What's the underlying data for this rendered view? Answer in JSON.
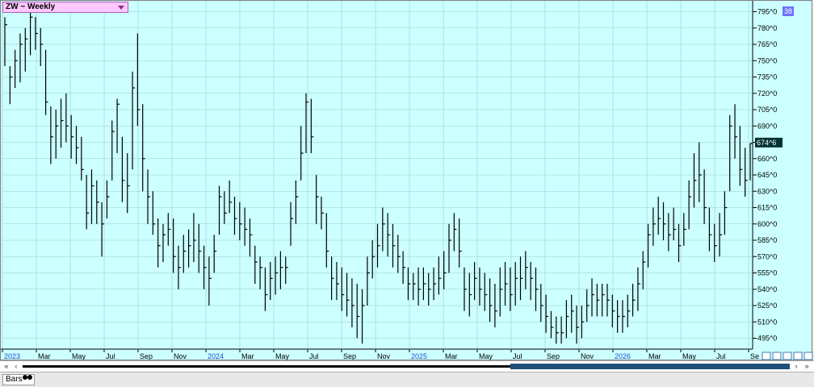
{
  "symbol_title": "ZW ~ Weekly",
  "corner_badge": "38",
  "price_tag": "674^6",
  "bottom_tab": "Bars",
  "colors": {
    "background": "#ccffff",
    "grid": "#99cccc",
    "bars": "#000000",
    "tag_bg": "#003333",
    "new_year": "#1f4fd8"
  },
  "icons": [
    "dropdown-arrow-icon",
    "scroll-left-icon",
    "scroll-right-icon",
    "chart-mini-icons"
  ],
  "chart_data": {
    "type": "ohlc",
    "title": "ZW ~ Weekly",
    "ylim": [
      485,
      805
    ],
    "y_ticks": [
      "795^0",
      "780^0",
      "765^0",
      "750^0",
      "735^0",
      "720^0",
      "705^0",
      "690^0",
      "675^0",
      "660^0",
      "645^0",
      "630^0",
      "615^0",
      "600^0",
      "585^0",
      "570^0",
      "555^0",
      "540^0",
      "525^0",
      "510^0",
      "495^0"
    ],
    "x_labels": [
      "2023",
      "Mar",
      "May",
      "Jul",
      "Sep",
      "Nov",
      "2024",
      "Mar",
      "May",
      "Jul",
      "Sep",
      "Nov",
      "2025",
      "Mar",
      "May",
      "Jul",
      "Sep",
      "Nov",
      "2026",
      "Mar",
      "May",
      "Jul",
      "Se"
    ],
    "new_year_labels": [
      "2023",
      "2024",
      "2025",
      "2026"
    ],
    "last_price": 674.75,
    "bars": [
      [
        790,
        745,
        783
      ],
      [
        745,
        710,
        735
      ],
      [
        760,
        725,
        750
      ],
      [
        775,
        730,
        765
      ],
      [
        780,
        740,
        770
      ],
      [
        800,
        755,
        790
      ],
      [
        790,
        760,
        775
      ],
      [
        780,
        745,
        765
      ],
      [
        760,
        700,
        712
      ],
      [
        708,
        655,
        680
      ],
      [
        705,
        660,
        690
      ],
      [
        715,
        670,
        695
      ],
      [
        720,
        675,
        690
      ],
      [
        700,
        660,
        680
      ],
      [
        690,
        655,
        670
      ],
      [
        680,
        640,
        650
      ],
      [
        645,
        595,
        610
      ],
      [
        650,
        600,
        635
      ],
      [
        640,
        600,
        620
      ],
      [
        620,
        570,
        600
      ],
      [
        640,
        605,
        625
      ],
      [
        695,
        640,
        685
      ],
      [
        715,
        665,
        710
      ],
      [
        680,
        620,
        640
      ],
      [
        665,
        610,
        635
      ],
      [
        740,
        650,
        725
      ],
      [
        775,
        690,
        705
      ],
      [
        710,
        630,
        660
      ],
      [
        650,
        600,
        625
      ],
      [
        630,
        590,
        600
      ],
      [
        605,
        560,
        580
      ],
      [
        600,
        565,
        590
      ],
      [
        610,
        580,
        595
      ],
      [
        605,
        555,
        570
      ],
      [
        580,
        540,
        560
      ],
      [
        590,
        555,
        575
      ],
      [
        595,
        560,
        580
      ],
      [
        610,
        565,
        585
      ],
      [
        600,
        555,
        575
      ],
      [
        580,
        540,
        560
      ],
      [
        570,
        525,
        550
      ],
      [
        590,
        555,
        575
      ],
      [
        635,
        590,
        625
      ],
      [
        630,
        600,
        610
      ],
      [
        640,
        610,
        620
      ],
      [
        625,
        590,
        605
      ],
      [
        620,
        585,
        600
      ],
      [
        615,
        580,
        595
      ],
      [
        605,
        570,
        590
      ],
      [
        580,
        545,
        565
      ],
      [
        570,
        540,
        560
      ],
      [
        560,
        520,
        535
      ],
      [
        565,
        530,
        550
      ],
      [
        570,
        535,
        555
      ],
      [
        575,
        540,
        560
      ],
      [
        570,
        545,
        560
      ],
      [
        620,
        580,
        605
      ],
      [
        640,
        600,
        625
      ],
      [
        690,
        640,
        665
      ],
      [
        720,
        665,
        712
      ],
      [
        715,
        665,
        680
      ],
      [
        645,
        600,
        625
      ],
      [
        625,
        595,
        610
      ],
      [
        610,
        560,
        575
      ],
      [
        570,
        530,
        550
      ],
      [
        565,
        530,
        545
      ],
      [
        560,
        520,
        535
      ],
      [
        555,
        515,
        530
      ],
      [
        550,
        505,
        525
      ],
      [
        545,
        495,
        515
      ],
      [
        540,
        490,
        525
      ],
      [
        570,
        525,
        555
      ],
      [
        585,
        550,
        570
      ],
      [
        600,
        560,
        580
      ],
      [
        615,
        575,
        600
      ],
      [
        610,
        570,
        590
      ],
      [
        600,
        560,
        580
      ],
      [
        590,
        555,
        570
      ],
      [
        575,
        545,
        560
      ],
      [
        560,
        530,
        545
      ],
      [
        555,
        530,
        545
      ],
      [
        560,
        525,
        540
      ],
      [
        560,
        530,
        545
      ],
      [
        555,
        525,
        540
      ],
      [
        560,
        530,
        545
      ],
      [
        570,
        535,
        550
      ],
      [
        575,
        540,
        555
      ],
      [
        600,
        555,
        585
      ],
      [
        610,
        575,
        595
      ],
      [
        605,
        560,
        575
      ],
      [
        560,
        520,
        540
      ],
      [
        555,
        515,
        535
      ],
      [
        565,
        530,
        550
      ],
      [
        560,
        525,
        540
      ],
      [
        555,
        520,
        535
      ],
      [
        550,
        510,
        525
      ],
      [
        545,
        505,
        520
      ],
      [
        560,
        515,
        540
      ],
      [
        565,
        525,
        545
      ],
      [
        560,
        520,
        535
      ],
      [
        565,
        525,
        550
      ],
      [
        570,
        530,
        550
      ],
      [
        575,
        540,
        560
      ],
      [
        565,
        530,
        550
      ],
      [
        560,
        520,
        540
      ],
      [
        545,
        510,
        525
      ],
      [
        535,
        500,
        515
      ],
      [
        520,
        495,
        505
      ],
      [
        515,
        490,
        500
      ],
      [
        515,
        490,
        500
      ],
      [
        530,
        495,
        515
      ],
      [
        535,
        500,
        520
      ],
      [
        525,
        490,
        505
      ],
      [
        525,
        495,
        510
      ],
      [
        540,
        510,
        525
      ],
      [
        550,
        515,
        535
      ],
      [
        545,
        515,
        530
      ],
      [
        545,
        515,
        535
      ],
      [
        545,
        515,
        530
      ],
      [
        535,
        505,
        520
      ],
      [
        530,
        500,
        515
      ],
      [
        530,
        500,
        515
      ],
      [
        535,
        505,
        520
      ],
      [
        545,
        515,
        530
      ],
      [
        560,
        520,
        545
      ],
      [
        575,
        540,
        565
      ],
      [
        600,
        560,
        590
      ],
      [
        615,
        580,
        600
      ],
      [
        625,
        590,
        605
      ],
      [
        620,
        585,
        600
      ],
      [
        610,
        575,
        590
      ],
      [
        615,
        585,
        595
      ],
      [
        600,
        565,
        580
      ],
      [
        610,
        580,
        595
      ],
      [
        640,
        595,
        625
      ],
      [
        665,
        615,
        640
      ],
      [
        675,
        620,
        645
      ],
      [
        650,
        600,
        615
      ],
      [
        615,
        575,
        590
      ],
      [
        600,
        565,
        580
      ],
      [
        610,
        570,
        590
      ],
      [
        630,
        590,
        615
      ],
      [
        700,
        630,
        690
      ],
      [
        710,
        660,
        680
      ],
      [
        690,
        635,
        650
      ],
      [
        670,
        625,
        640
      ],
      [
        674,
        640,
        674
      ]
    ]
  }
}
